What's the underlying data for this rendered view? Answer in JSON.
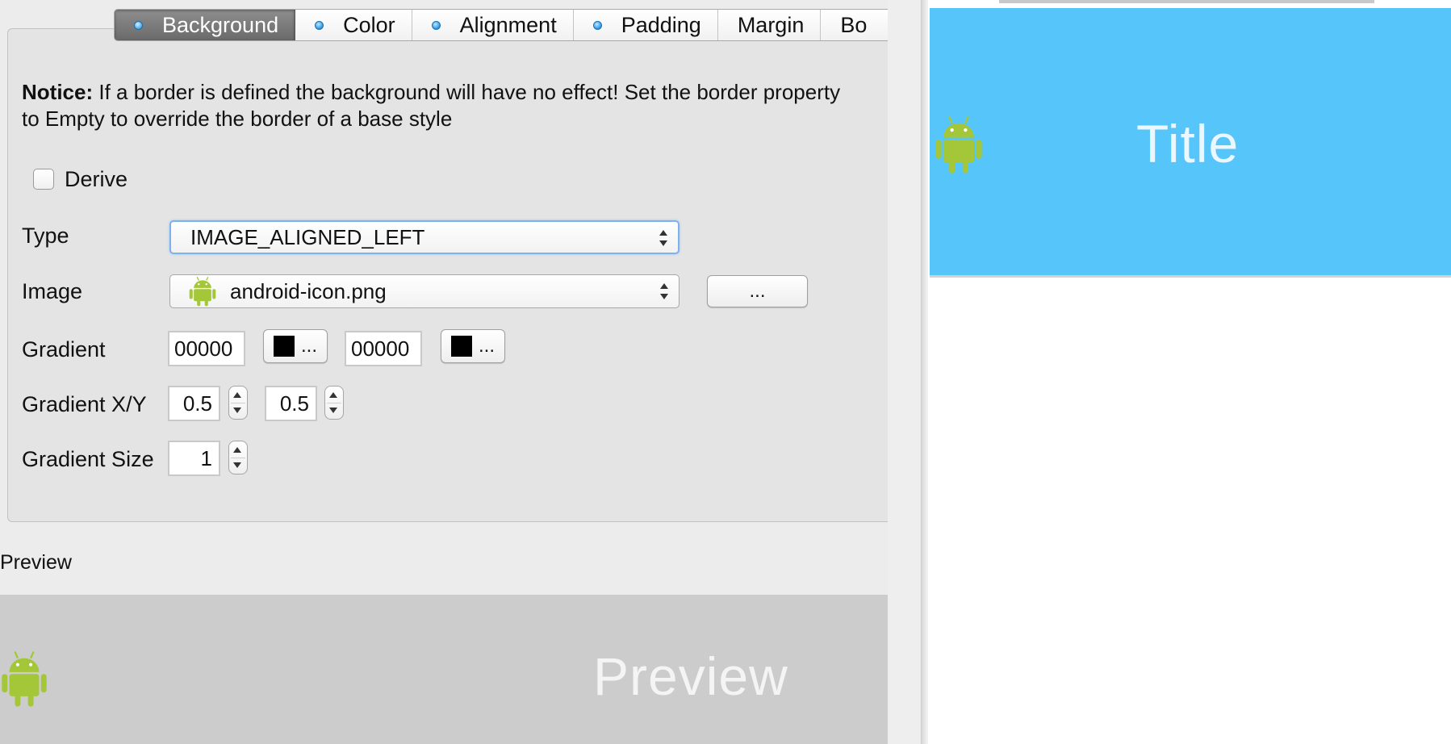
{
  "tabs": [
    {
      "label": "Background",
      "selected": true,
      "dot": true
    },
    {
      "label": "Color",
      "selected": false,
      "dot": true
    },
    {
      "label": "Alignment",
      "selected": false,
      "dot": true
    },
    {
      "label": "Padding",
      "selected": false,
      "dot": true
    },
    {
      "label": "Margin",
      "selected": false,
      "dot": false
    },
    {
      "label": "Bo",
      "selected": false,
      "dot": false
    }
  ],
  "notice": {
    "bold": "Notice:",
    "text": " If a border is defined the background will have no effect! Set the border property to Empty to override the border of a base style"
  },
  "derive": {
    "label": "Derive",
    "checked": false
  },
  "type": {
    "label": "Type",
    "value": "IMAGE_ALIGNED_LEFT"
  },
  "image": {
    "label": "Image",
    "value": "android-icon.png",
    "browse_label": "..."
  },
  "gradient": {
    "label": "Gradient",
    "color1": "00000",
    "color2": "00000",
    "picker_label": "...",
    "swatch_color": "#000000"
  },
  "gradient_xy": {
    "label": "Gradient X/Y",
    "x": "0.5",
    "y": "0.5"
  },
  "gradient_size": {
    "label": "Gradient Size",
    "value": "1"
  },
  "preview": {
    "section_label": "Preview",
    "text": "Preview",
    "bg_color": "#cccccc"
  },
  "right_preview": {
    "title": "Title",
    "header_color": "#56c5fa"
  },
  "icons": {
    "android": "android-robot-icon",
    "android_color": "#a4c639"
  }
}
